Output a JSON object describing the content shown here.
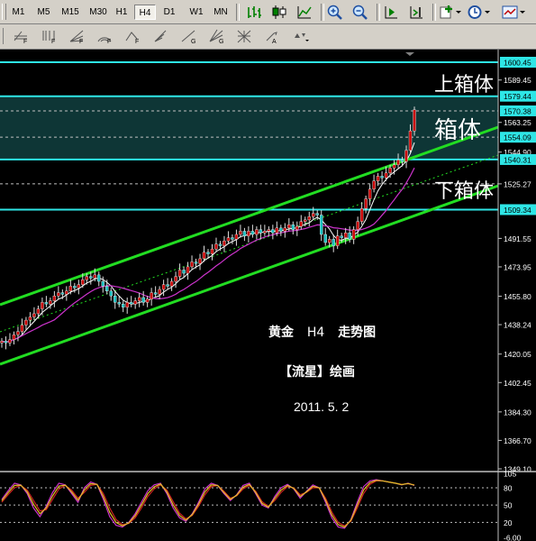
{
  "toolbar": {
    "timeframes": [
      {
        "label": "M1",
        "active": false
      },
      {
        "label": "M5",
        "active": false
      },
      {
        "label": "M15",
        "active": false
      },
      {
        "label": "M30",
        "active": false
      },
      {
        "label": "H1",
        "active": false
      },
      {
        "label": "H4",
        "active": true
      },
      {
        "label": "D1",
        "active": false
      },
      {
        "label": "W1",
        "active": false
      },
      {
        "label": "MN",
        "active": false
      }
    ],
    "icons_row1": [
      "bar-chart-icon",
      "candlestick-chart-icon",
      "line-chart-icon",
      "zoom-in-icon",
      "zoom-out-icon",
      "auto-scroll-icon",
      "chart-shift-icon",
      "indicators-icon",
      "periods-icon",
      "templates-icon"
    ],
    "icons_row2": [
      "fibo-retracement-icon",
      "fibo-time-zones-icon",
      "fibo-fan-icon",
      "fibo-arcs-icon",
      "fibo-expansion-icon",
      "andrews-pitchfork-icon",
      "gann-line-icon",
      "gann-fan-icon",
      "gann-grid-icon",
      "text-label-icon",
      "arrows-menu-icon"
    ]
  },
  "colors": {
    "channel": "#22dd22",
    "levels": "#2ee6e6",
    "bull_candle": "#cc0000",
    "bear_candle": "#18c0c0",
    "ma_fast": "#ffffff",
    "ma_slow": "#cc33cc",
    "grid": "#c0c0c0"
  },
  "price_axis": {
    "ticks": [
      "1600.45",
      "1589.45",
      "1579.44",
      "1570.38",
      "1563.25",
      "1554.09",
      "1544.90",
      "1540.31",
      "1525.27",
      "1509.34",
      "1491.55",
      "1473.95",
      "1455.80",
      "1438.24",
      "1420.05",
      "1402.45",
      "1384.30",
      "1366.70",
      "1349.10"
    ]
  },
  "annotations": {
    "upper_box": "上箱体",
    "box": "箱体",
    "lower_box": "下箱体"
  },
  "caption": {
    "title_symbol": "黄金",
    "title_tf": "H4",
    "title_label": "走势图",
    "author": "【流星】绘画",
    "date": "2011. 5. 2"
  },
  "oscillator": {
    "levels": [
      "105",
      "80",
      "50",
      "20",
      "-6.00"
    ]
  },
  "chart_data": {
    "type": "candlestick",
    "symbol": "黄金",
    "timeframe": "H4",
    "ylim": [
      1349.1,
      1600.45
    ],
    "horizontal_levels": [
      1600.45,
      1579.44,
      1540.31,
      1509.34
    ],
    "box_zone": [
      1540.31,
      1579.44
    ],
    "dashed_levels": [
      1570.38,
      1554.09,
      1525.27
    ],
    "closes": [
      1428,
      1427,
      1429,
      1432,
      1434,
      1438,
      1441,
      1443,
      1445,
      1448,
      1452,
      1451,
      1453,
      1456,
      1458,
      1457,
      1459,
      1462,
      1461,
      1463,
      1466,
      1468,
      1467,
      1469,
      1465,
      1462,
      1459,
      1456,
      1452,
      1451,
      1449,
      1452,
      1451,
      1453,
      1455,
      1452,
      1454,
      1458,
      1457,
      1460,
      1463,
      1462,
      1465,
      1468,
      1472,
      1470,
      1474,
      1477,
      1476,
      1479,
      1483,
      1482,
      1485,
      1488,
      1487,
      1490,
      1492,
      1491,
      1494,
      1496,
      1493,
      1496,
      1494,
      1497,
      1495,
      1496,
      1497,
      1495,
      1498,
      1496,
      1498,
      1500,
      1497,
      1499,
      1502,
      1503,
      1505,
      1507,
      1506,
      1494,
      1489,
      1491,
      1487,
      1493,
      1492,
      1495,
      1491,
      1497,
      1502,
      1510,
      1516,
      1522,
      1527,
      1530,
      1529,
      1532,
      1535,
      1537,
      1540,
      1539,
      1546,
      1558,
      1571
    ],
    "oscillator_k": [
      60,
      75,
      88,
      85,
      70,
      45,
      30,
      48,
      72,
      88,
      85,
      70,
      55,
      80,
      90,
      86,
      60,
      30,
      15,
      12,
      20,
      35,
      55,
      75,
      85,
      88,
      70,
      45,
      28,
      22,
      35,
      55,
      78,
      88,
      84,
      70,
      58,
      68,
      84,
      88,
      70,
      50,
      45,
      65,
      80,
      86,
      78,
      62,
      74,
      85,
      80,
      55,
      28,
      12,
      10,
      25,
      55,
      82,
      92,
      94,
      92,
      90,
      88,
      85,
      88,
      84
    ],
    "oscillator_d": [
      55,
      68,
      80,
      84,
      76,
      58,
      40,
      42,
      60,
      78,
      84,
      76,
      62,
      72,
      84,
      86,
      70,
      45,
      25,
      16,
      18,
      28,
      45,
      65,
      78,
      85,
      76,
      56,
      36,
      26,
      32,
      48,
      68,
      82,
      84,
      74,
      62,
      66,
      78,
      84,
      74,
      56,
      48,
      58,
      72,
      82,
      80,
      68,
      72,
      80,
      80,
      62,
      38,
      20,
      14,
      22,
      45,
      70,
      86,
      92,
      92,
      90,
      88,
      86,
      87,
      85
    ]
  }
}
